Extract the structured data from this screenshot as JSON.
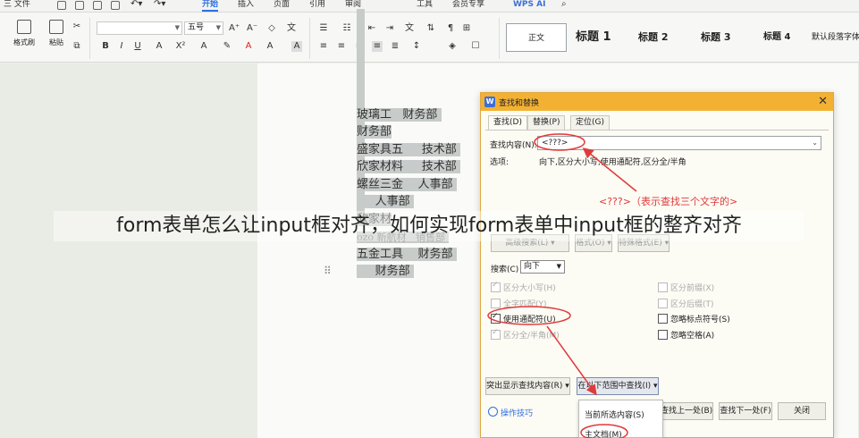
{
  "menubar": {
    "file_label": "三 文件",
    "tabs": [
      "开始",
      "插入",
      "页面",
      "引用",
      "审阅",
      "工具",
      "会员专享"
    ],
    "active_tab": "开始",
    "wps_ai": "WPS AI"
  },
  "ribbon": {
    "format_painter": "格式刷",
    "paste": "粘贴",
    "font_name": "",
    "font_size": "五号",
    "styles": [
      "正文",
      "标题 1",
      "标题 2",
      "标题 3",
      "标题 4",
      "默认段落字体"
    ]
  },
  "document": {
    "lines": [
      [
        "玻璃工",
        "财务部"
      ],
      [
        "财务部",
        ""
      ],
      [
        "盛家具五",
        "技术部"
      ],
      [
        "欣家材料",
        "技术部"
      ],
      [
        "螺丝三金",
        "人事部"
      ],
      [
        "人事部",
        ""
      ],
      [
        "欣家材",
        ""
      ],
      [
        "ozo 新航材",
        "销售部"
      ],
      [
        "五金工具",
        "财务部"
      ],
      [
        "财务部",
        ""
      ]
    ]
  },
  "dialog": {
    "title": "查找和替换",
    "tabs": [
      "查找(D)",
      "替换(P)",
      "定位(G)"
    ],
    "find_label": "查找内容(N):",
    "find_value": "<???>",
    "options_label": "选项:",
    "options_value": "向下,区分大小写,使用通配符,区分全/半角",
    "advanced_btn": "高级搜索(L) ▾",
    "format_btn": "格式(O) ▾",
    "special_btn": "特殊格式(E) ▾",
    "search_label": "搜索(C)",
    "search_value": "向下",
    "checks_left": [
      {
        "label": "区分大小写(H)",
        "checked": true,
        "enabled": false
      },
      {
        "label": "全字匹配(Y)",
        "checked": false,
        "enabled": false
      },
      {
        "label": "使用通配符(U)",
        "checked": true,
        "enabled": true
      },
      {
        "label": "区分全/半角(M)",
        "checked": true,
        "enabled": false
      }
    ],
    "checks_right": [
      {
        "label": "区分前缀(X)",
        "checked": false,
        "enabled": false
      },
      {
        "label": "区分后缀(T)",
        "checked": false,
        "enabled": false
      },
      {
        "label": "忽略标点符号(S)",
        "checked": false,
        "enabled": true
      },
      {
        "label": "忽略空格(A)",
        "checked": false,
        "enabled": true
      }
    ],
    "highlight_btn": "突出显示查找内容(R) ▾",
    "find_in_btn": "在以下范围中查找(I) ▾",
    "tips": "操作技巧",
    "find_prev": "查找上一处(B)",
    "find_next": "查找下一处(F)",
    "close": "关闭"
  },
  "dropdown": {
    "options": [
      "当前所选内容(S)",
      "主文档(M)"
    ]
  },
  "annotation": "<???>（表示查找三个文字的>",
  "caption": "form表单怎么让input框对齐，如何实现form表单中input框的整齐对齐"
}
